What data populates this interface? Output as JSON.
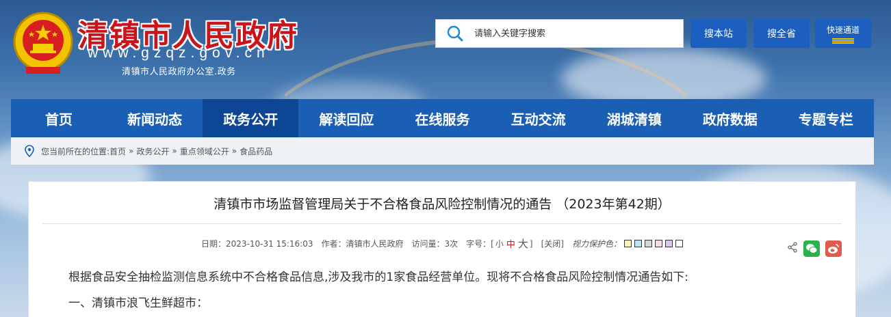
{
  "header": {
    "site_title": "清镇市人民政府",
    "site_url": "www.gzqz.gov.cn",
    "site_sub": "清镇市人民政府办公室.政务"
  },
  "search": {
    "placeholder": "请输入关键字搜索",
    "btn_site": "搜本站",
    "btn_all": "搜全省",
    "btn_quick": "快速通道"
  },
  "nav": {
    "items": [
      "首页",
      "新闻动态",
      "政务公开",
      "解读回应",
      "在线服务",
      "互动交流",
      "湖城清镇",
      "政府数据",
      "专题专栏"
    ],
    "active_index": 2
  },
  "breadcrumb": {
    "prefix": "您当前所在的位置:",
    "items": [
      "首页",
      "政务公开",
      "重点领域公开",
      "食品药品"
    ],
    "sep": "»"
  },
  "article": {
    "title": "清镇市市场监督管理局关于不合格食品风险控制情况的通告 （2023年第42期）",
    "date": "日期：2023-10-31 15:16:03",
    "author": "作者：清镇市人民政府",
    "views": "访问量：3次",
    "font_label": "字号：[",
    "font_small": "小",
    "font_mid": "中",
    "font_big": "大",
    "font_close": "]",
    "close_label": "[关闭]",
    "eye_label": "视力保护色：",
    "swatch_colors": [
      "#fdf4b8",
      "#bfe3f5",
      "#d6d6d6",
      "#f4dbe6",
      "#d9c7ee",
      "#ffffff"
    ],
    "para1": "根据食品安全抽检监测信息系统中不合格食品信息,涉及我市的1家食品经营单位。现将不合格食品风险控制情况通告如下:",
    "para2": "一、清镇市浪飞生鲜超市："
  },
  "colors": {
    "nav_bg": "#1a5fb4",
    "nav_active": "#0d4695",
    "title_red": "#c8141b"
  },
  "icons": [
    "national-emblem-icon",
    "search-icon",
    "location-pin-icon",
    "share-icon",
    "wechat-icon",
    "weibo-icon"
  ]
}
